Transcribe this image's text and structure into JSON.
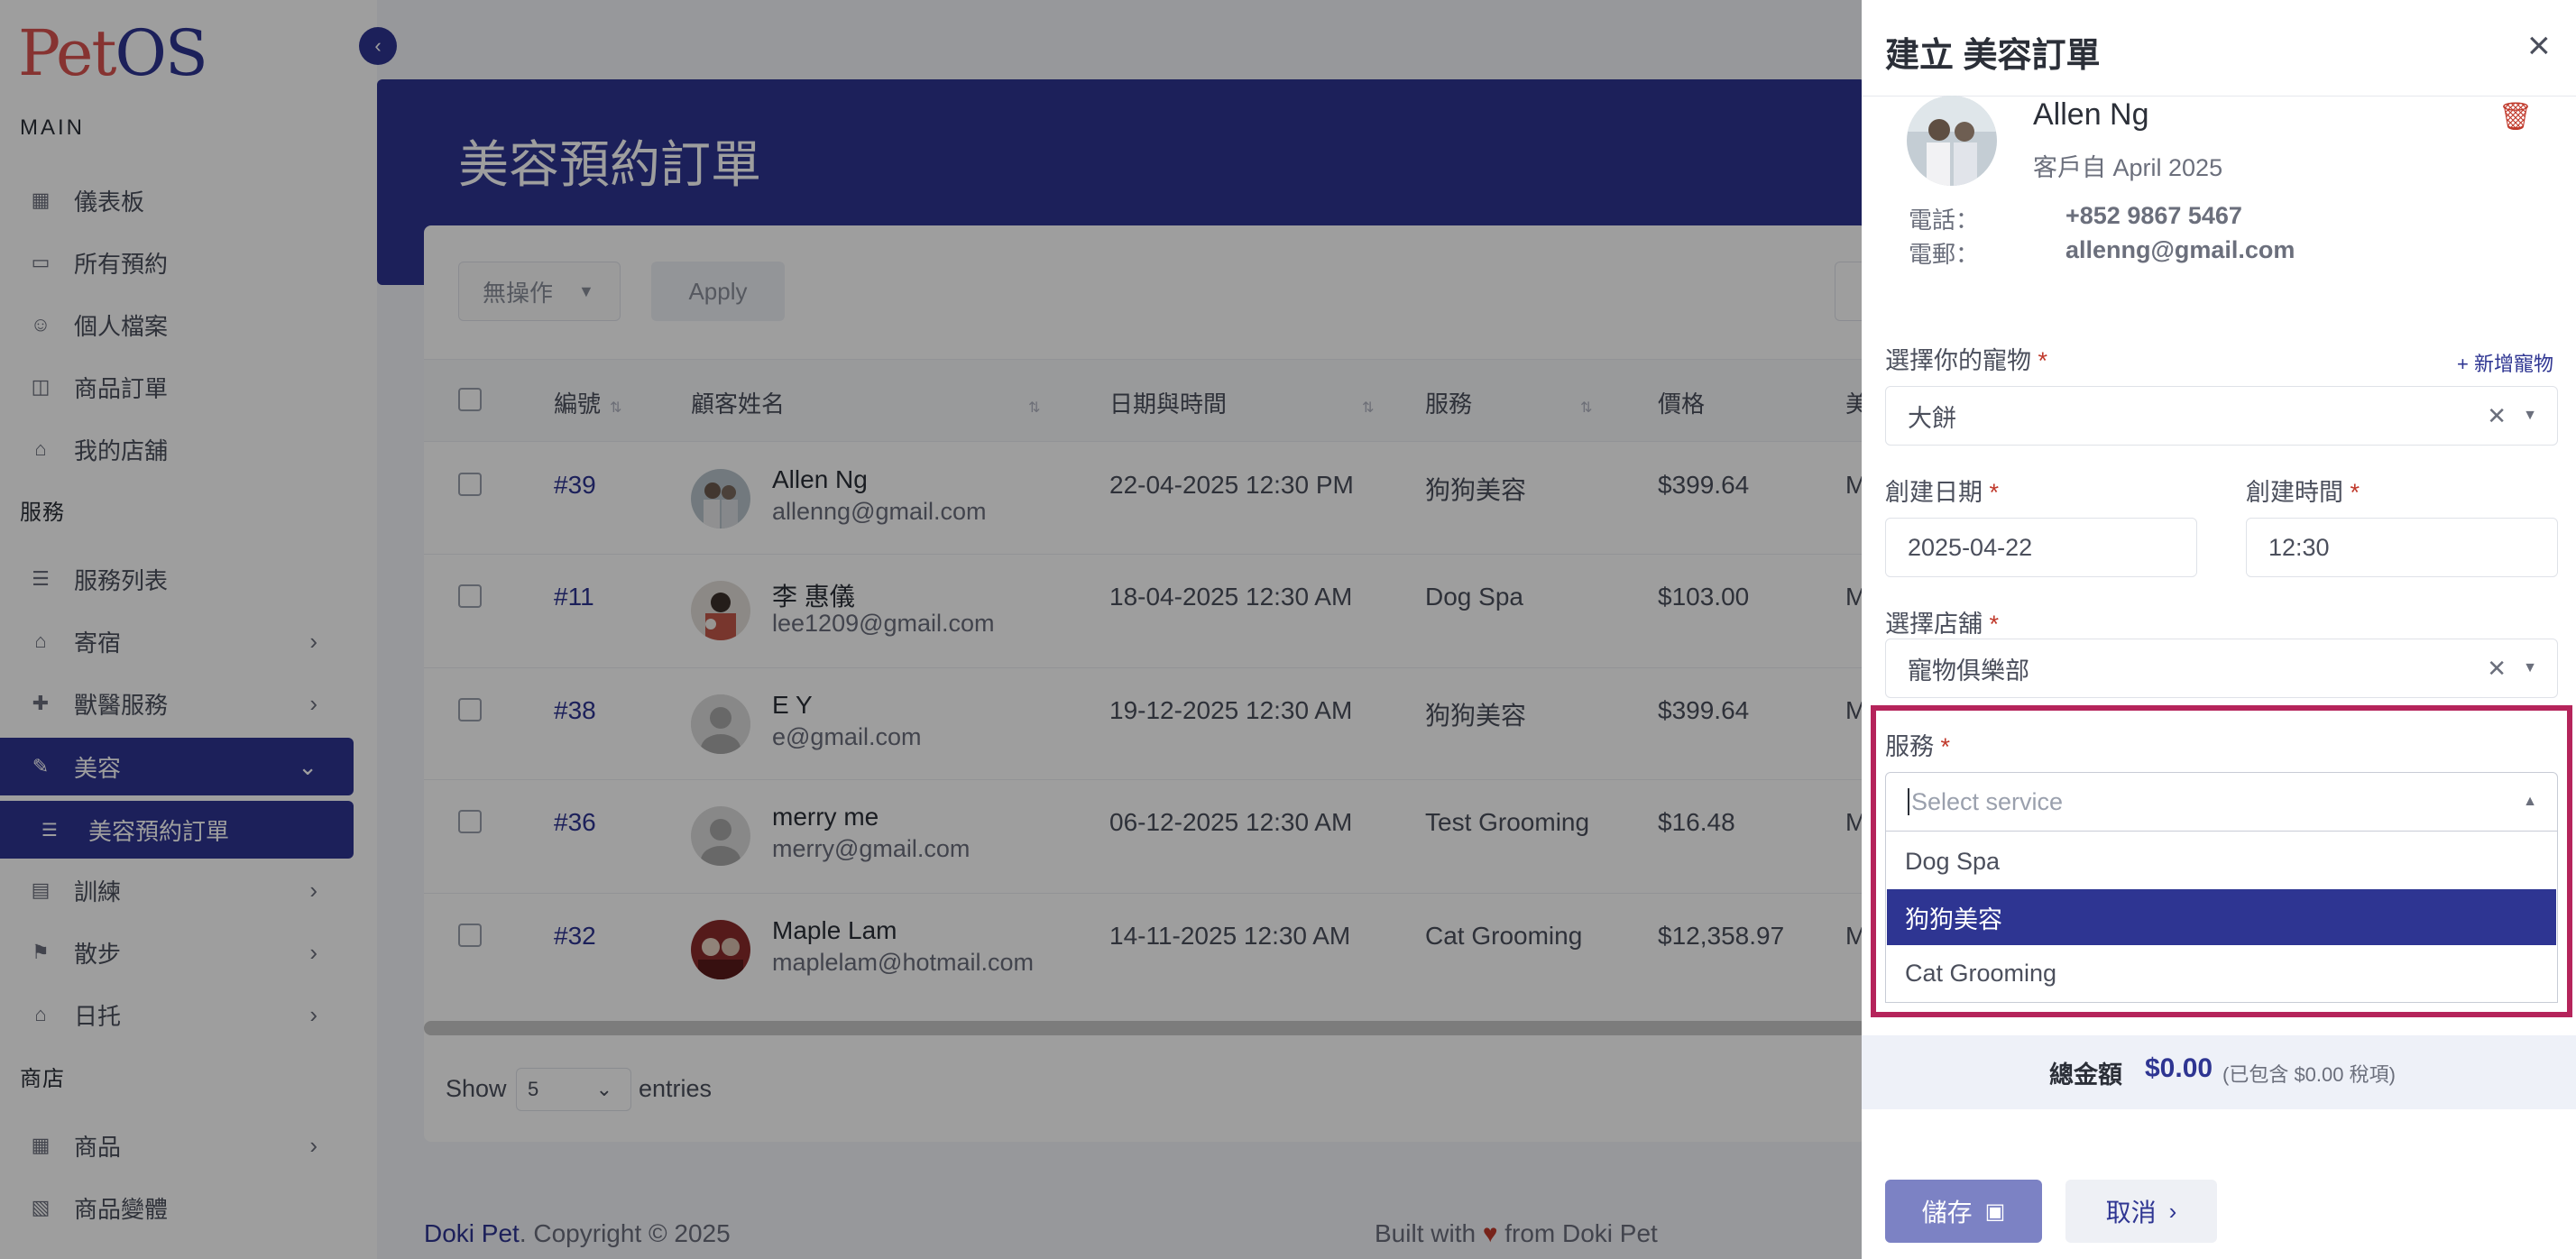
{
  "app": {
    "logo_pet": "Pet",
    "logo_os": "OS"
  },
  "sidebar": {
    "main_label": "MAIN",
    "main_items": [
      {
        "label": "儀表板",
        "icon": "dashboard-icon"
      },
      {
        "label": "所有預約",
        "icon": "calendar-icon"
      },
      {
        "label": "個人檔案",
        "icon": "user-icon"
      },
      {
        "label": "商品訂單",
        "icon": "bag-icon"
      },
      {
        "label": "我的店舖",
        "icon": "store-icon"
      }
    ],
    "services_label": "服務",
    "service_items": [
      {
        "label": "服務列表",
        "icon": "list-icon"
      },
      {
        "label": "寄宿",
        "icon": "home-icon"
      },
      {
        "label": "獸醫服務",
        "icon": "vet-icon"
      },
      {
        "label": "美容",
        "icon": "brush-icon"
      },
      {
        "label": "美容預約訂單",
        "icon": "sub-list-icon"
      },
      {
        "label": "訓練",
        "icon": "training-icon"
      },
      {
        "label": "散步",
        "icon": "walk-icon"
      },
      {
        "label": "日托",
        "icon": "daycare-icon"
      }
    ],
    "shop_label": "商店",
    "shop_items": [
      {
        "label": "商品",
        "icon": "product-icon"
      },
      {
        "label": "商品變體",
        "icon": "variant-icon"
      }
    ]
  },
  "page": {
    "title": "美容預約訂單",
    "bulk_action": "無操作",
    "apply_label": "Apply",
    "columns": [
      "編號",
      "顧客姓名",
      "日期與時間",
      "服務",
      "價格",
      "美"
    ],
    "rows": [
      {
        "id": "#39",
        "name": "Allen Ng",
        "email": "allenng@gmail.com",
        "datetime": "22-04-2025 12:30 PM",
        "service": "狗狗美容",
        "price": "$399.64",
        "trunc": "M"
      },
      {
        "id": "#11",
        "name": "李 惠儀",
        "email": "lee1209@gmail.com",
        "datetime": "18-04-2025 12:30 AM",
        "service": "Dog Spa",
        "price": "$103.00",
        "trunc": "M"
      },
      {
        "id": "#38",
        "name": "E Y",
        "email": "e@gmail.com",
        "datetime": "19-12-2025 12:30 AM",
        "service": "狗狗美容",
        "price": "$399.64",
        "trunc": "M"
      },
      {
        "id": "#36",
        "name": "merry me",
        "email": "merry@gmail.com",
        "datetime": "06-12-2025 12:30 AM",
        "service": "Test Grooming",
        "price": "$16.48",
        "trunc": "M"
      },
      {
        "id": "#32",
        "name": "Maple Lam",
        "email": "maplelam@hotmail.com",
        "datetime": "14-11-2025 12:30 AM",
        "service": "Cat Grooming",
        "price": "$12,358.97",
        "trunc": "M"
      }
    ],
    "show_label": "Show",
    "show_value": "5",
    "entries_label": "entries"
  },
  "footer": {
    "brand": "Doki Pet",
    "copyright": ". Copyright © 2025",
    "built_with": "Built with",
    "from": "from Doki Pet"
  },
  "drawer": {
    "title": "建立 美容訂單",
    "customer": {
      "name": "Allen Ng",
      "since": "客戶自 April 2025",
      "phone_label": "電話：",
      "phone": "+852 9867 5467",
      "email_label": "電郵：",
      "email": "allenng@gmail.com"
    },
    "pet_label": "選擇你的寵物",
    "add_pet": "+ 新增寵物",
    "pet_value": "大餅",
    "date_label": "創建日期",
    "date_value": "2025-04-22",
    "time_label": "創建時間",
    "time_value": "12:30",
    "store_label": "選擇店舖",
    "store_value": "寵物俱樂部",
    "service_label": "服務",
    "service_placeholder": "Select service",
    "service_options": [
      "Dog Spa",
      "狗狗美容",
      "Cat Grooming"
    ],
    "service_highlighted": "狗狗美容",
    "total_label": "總金額",
    "total_value": "$0.00",
    "total_tax": "(已包含 $0.00 稅項)",
    "save_label": "儲存",
    "cancel_label": "取消"
  },
  "colors": {
    "primary": "#2e3592",
    "danger": "#c0392b",
    "highlight_border": "#b5245b"
  }
}
